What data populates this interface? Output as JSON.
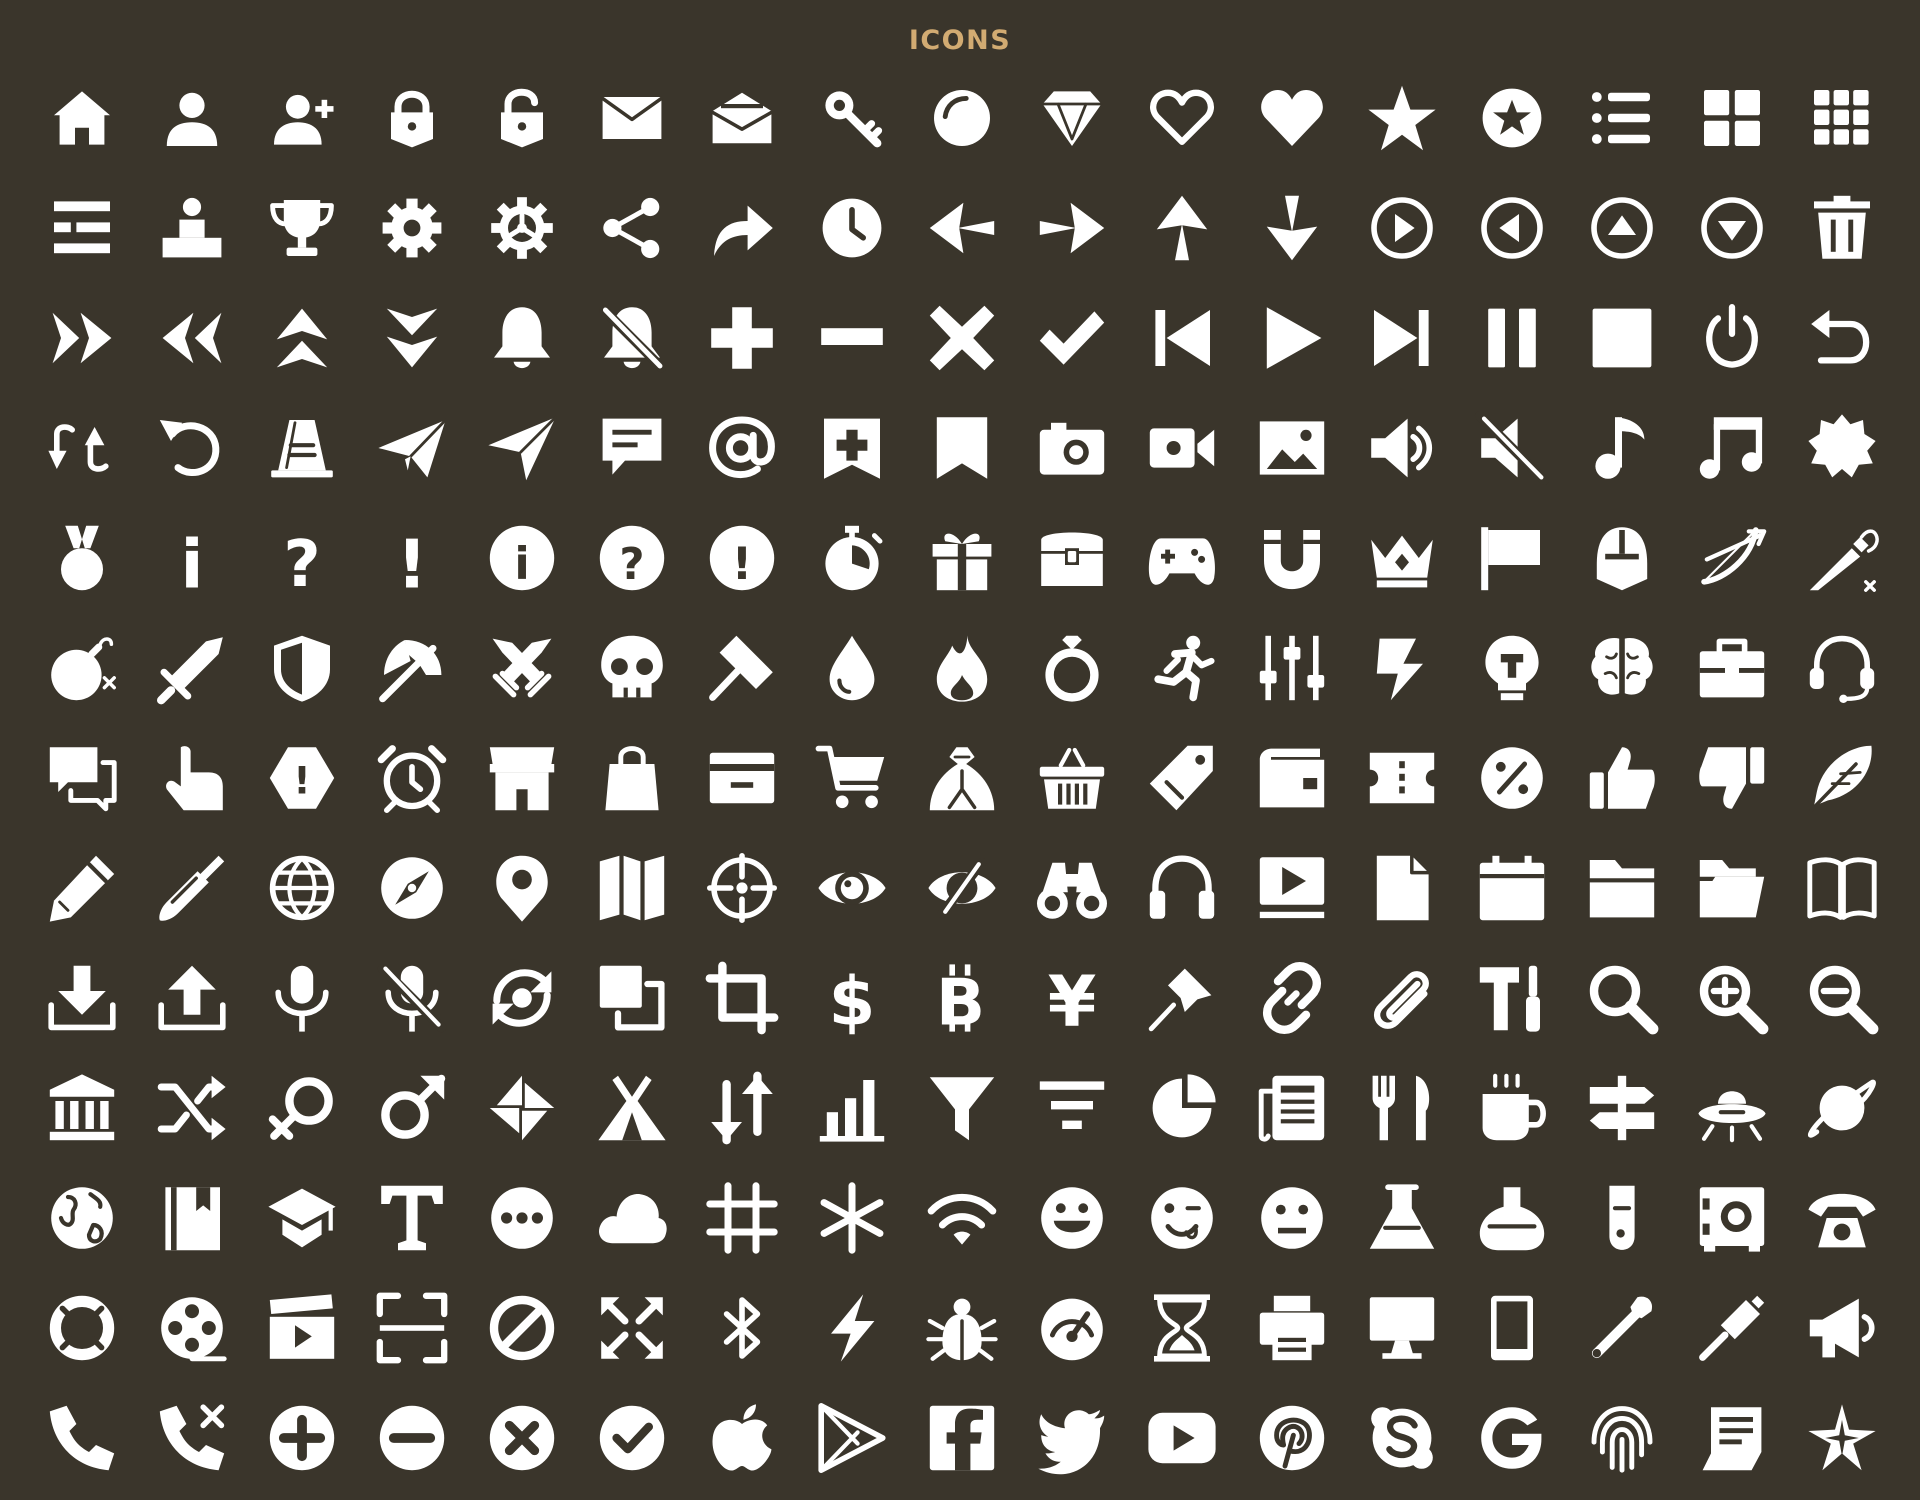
{
  "title": "ICONS",
  "colors": {
    "background": "#3a352b",
    "title": "#d2ab72",
    "icon": "#ffffff"
  },
  "icons": [
    "home-icon",
    "user-icon",
    "user-add-icon",
    "lock-icon",
    "unlock-icon",
    "mail-icon",
    "mail-open-icon",
    "key-icon",
    "orb-icon",
    "diamond-icon",
    "heart-outline-icon",
    "heart-icon",
    "star-icon",
    "star-badge-icon",
    "list-icon",
    "grid-icon",
    "grid-small-icon",
    "menu-list-icon",
    "podium-user-icon",
    "trophy-icon",
    "gear-icon",
    "gear-alt-icon",
    "share-icon",
    "forward-icon",
    "clock-icon",
    "arrow-left-icon",
    "arrow-right-icon",
    "arrow-up-icon",
    "arrow-down-icon",
    "circle-arrow-right-icon",
    "circle-arrow-left-icon",
    "circle-arrow-up-icon",
    "circle-arrow-down-icon",
    "trash-icon",
    "double-chevron-right-icon",
    "double-chevron-left-icon",
    "double-chevron-up-icon",
    "double-chevron-down-icon",
    "bell-icon",
    "bell-off-icon",
    "plus-icon",
    "minus-icon",
    "close-icon",
    "check-icon",
    "skip-back-icon",
    "play-icon",
    "skip-forward-icon",
    "pause-icon",
    "stop-icon",
    "power-icon",
    "undo-icon",
    "swap-arrows-icon",
    "rotate-icon",
    "cone-icon",
    "paper-plane-icon",
    "send-icon",
    "chat-icon",
    "at-icon",
    "bookmark-add-icon",
    "bookmark-icon",
    "camera-icon",
    "video-camera-icon",
    "image-icon",
    "volume-icon",
    "mute-icon",
    "music-note-icon",
    "music-notes-icon",
    "badge-icon",
    "medal-icon",
    "info-icon",
    "question-icon",
    "exclamation-icon",
    "info-circle-icon",
    "question-circle-icon",
    "exclamation-circle-icon",
    "stopwatch-icon",
    "gift-icon",
    "treasure-chest-icon",
    "gamepad-icon",
    "magnet-icon",
    "crown-icon",
    "flag-icon",
    "helmet-icon",
    "bow-icon",
    "potion-icon",
    "bomb-icon",
    "sword-icon",
    "shield-icon",
    "axe-icon",
    "crossed-swords-icon",
    "skull-icon",
    "hammer-icon",
    "water-drop-icon",
    "fire-icon",
    "ring-icon",
    "running-icon",
    "sliders-icon",
    "lightning-icon",
    "lightbulb-icon",
    "brain-icon",
    "toolbox-icon",
    "headset-icon",
    "chat-bubbles-icon",
    "pointer-hand-icon",
    "warning-hexagon-icon",
    "alarm-clock-icon",
    "shop-icon",
    "shopping-bag-icon",
    "credit-card-icon",
    "cart-icon",
    "money-bag-icon",
    "basket-icon",
    "tag-icon",
    "wallet-icon",
    "ticket-icon",
    "discount-icon",
    "thumbs-up-icon",
    "thumbs-down-icon",
    "feather-icon",
    "pencil-icon",
    "pen-icon",
    "globe-icon",
    "compass-icon",
    "map-pin-icon",
    "map-icon",
    "crosshair-icon",
    "eye-icon",
    "eye-off-icon",
    "binoculars-icon",
    "headphones-icon",
    "video-player-icon",
    "file-icon",
    "calendar-icon",
    "folder-icon",
    "folder-open-icon",
    "book-icon",
    "download-icon",
    "upload-icon",
    "microphone-icon",
    "microphone-off-icon",
    "refresh-icon",
    "copy-icon",
    "crop-icon",
    "dollar-icon",
    "bitcoin-icon",
    "yen-icon",
    "pin-icon",
    "link-icon",
    "paperclip-icon",
    "tools-icon",
    "search-icon",
    "zoom-in-icon",
    "zoom-out-icon",
    "bank-icon",
    "shuffle-icon",
    "female-icon",
    "male-icon",
    "pinwheel-icon",
    "tent-icon",
    "sort-icon",
    "bar-chart-icon",
    "filter-icon",
    "sort-lines-icon",
    "pie-chart-icon",
    "newspaper-icon",
    "fork-knife-icon",
    "coffee-icon",
    "signpost-icon",
    "ufo-icon",
    "planet-icon",
    "earth-icon",
    "book-closed-icon",
    "graduation-cap-icon",
    "text-icon",
    "more-icon",
    "cloud-icon",
    "hashtag-icon",
    "asterisk-icon",
    "wifi-icon",
    "smile-icon",
    "wink-icon",
    "neutral-face-icon",
    "flask-icon",
    "round-flask-icon",
    "test-tube-icon",
    "safe-icon",
    "telephone-icon",
    "lifebuoy-icon",
    "film-reel-icon",
    "clapperboard-icon",
    "fullscreen-icon",
    "ban-icon",
    "expand-icon",
    "bluetooth-icon",
    "flash-icon",
    "bug-icon",
    "dashboard-icon",
    "hourglass-icon",
    "printer-icon",
    "monitor-icon",
    "tablet-icon",
    "wrench-icon",
    "screwdriver-icon",
    "megaphone-icon",
    "phone-icon",
    "phone-missed-icon",
    "plus-circle-icon",
    "minus-circle-icon",
    "close-circle-icon",
    "check-circle-icon",
    "apple-icon",
    "play-store-icon",
    "facebook-icon",
    "twitter-icon",
    "youtube-icon",
    "pinterest-icon",
    "skype-icon",
    "google-icon",
    "fingerprint-icon",
    "receipt-icon",
    "sparkle-icon"
  ]
}
